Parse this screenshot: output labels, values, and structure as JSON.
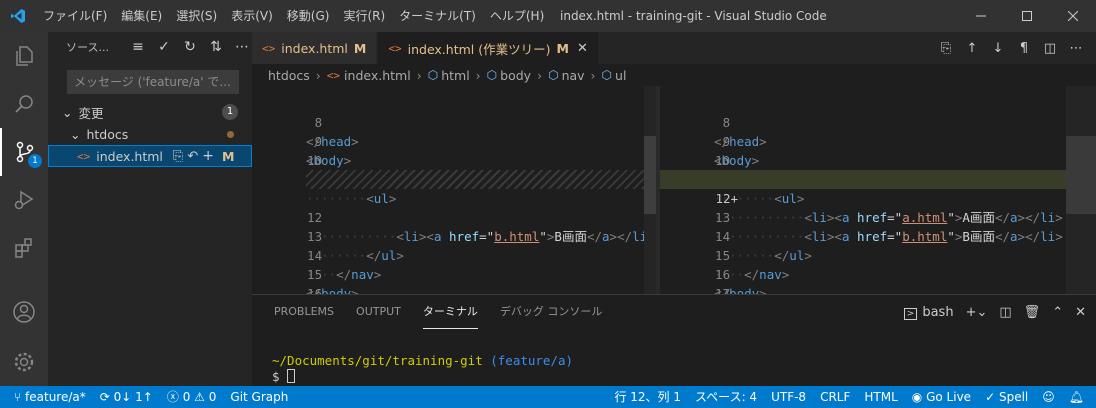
{
  "titlebar": {
    "menu": [
      "ファイル(F)",
      "編集(E)",
      "選択(S)",
      "表示(V)",
      "移動(G)",
      "実行(R)",
      "ターミナル(T)",
      "ヘルプ(H)"
    ],
    "title": "index.html - training-git - Visual Studio Code"
  },
  "activity": {
    "scm_badge": "1"
  },
  "sidebar": {
    "title": "ソース...",
    "commit_placeholder": "メッセージ ('feature/a' で...",
    "group_label": "変更",
    "group_count": "1",
    "folder": "htdocs",
    "file": "index.html",
    "file_status": "M"
  },
  "tabs": [
    {
      "label": "index.html",
      "status": "M"
    },
    {
      "label": "index.html (作業ツリー)",
      "status": "M"
    }
  ],
  "breadcrumb": [
    "htdocs",
    "index.html",
    "html",
    "body",
    "nav",
    "ul"
  ],
  "diff_left": {
    "lines": [
      "8",
      "9",
      "10",
      "11",
      "",
      "12",
      "13",
      "14",
      "15",
      "16",
      "17"
    ]
  },
  "diff_right": {
    "lines": [
      "8",
      "9",
      "10",
      "11",
      "12+",
      "13",
      "14",
      "15",
      "16",
      "17",
      "18"
    ]
  },
  "code": {
    "head_close": "head",
    "body": "body",
    "nav": "nav",
    "ul": "ul",
    "li": "li",
    "a": "a",
    "href": "href",
    "link_a": "a.html",
    "link_b": "b.html",
    "text_a": "A画面",
    "text_b": "B画面",
    "html": "html"
  },
  "panel": {
    "tabs": [
      "PROBLEMS",
      "OUTPUT",
      "ターミナル",
      "デバッグ コンソール"
    ],
    "active_tab": "ターミナル",
    "shell": "bash",
    "terminal_path": "~/Documents/git/training-git",
    "terminal_branch": "(feature/a)",
    "prompt": "$"
  },
  "statusbar": {
    "branch": "feature/a*",
    "sync": "0↓ 1↑",
    "errors": "0",
    "warnings": "0",
    "git_graph": "Git Graph",
    "position": "行 12、列 1",
    "spaces": "スペース: 4",
    "encoding": "UTF-8",
    "eol": "CRLF",
    "language": "HTML",
    "go_live": "Go Live",
    "spell": "Spell"
  },
  "colors": {
    "accent": "#007acc",
    "modified": "#e2c08d",
    "added_line": "#373d29"
  }
}
